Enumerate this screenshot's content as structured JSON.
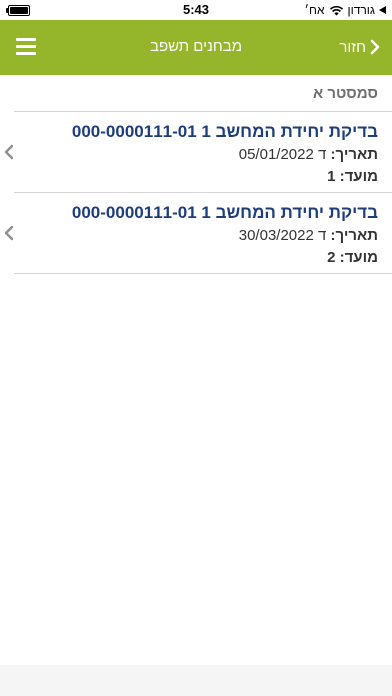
{
  "status_bar": {
    "time": "5:43",
    "carrier": "גורדון",
    "day": "אח׳"
  },
  "nav": {
    "title": "מבחנים תשפב",
    "back_label": "חזור"
  },
  "section": {
    "header": "סמסטר א"
  },
  "exams": [
    {
      "title": "בדיקת יחידת המחשב 1 000-0000111-01",
      "date_label": "תאריך:",
      "date_value": "ד 05/01/2022",
      "slot_label": "מועד:",
      "slot_value": "1"
    },
    {
      "title": "בדיקת יחידת המחשב 1 000-0000111-01",
      "date_label": "תאריך:",
      "date_value": "ד 30/03/2022",
      "slot_label": "מועד:",
      "slot_value": "2"
    }
  ],
  "colors": {
    "nav_background": "#95b62a",
    "title_text": "#1d3d7b",
    "section_header_text": "#6e6e6e"
  }
}
